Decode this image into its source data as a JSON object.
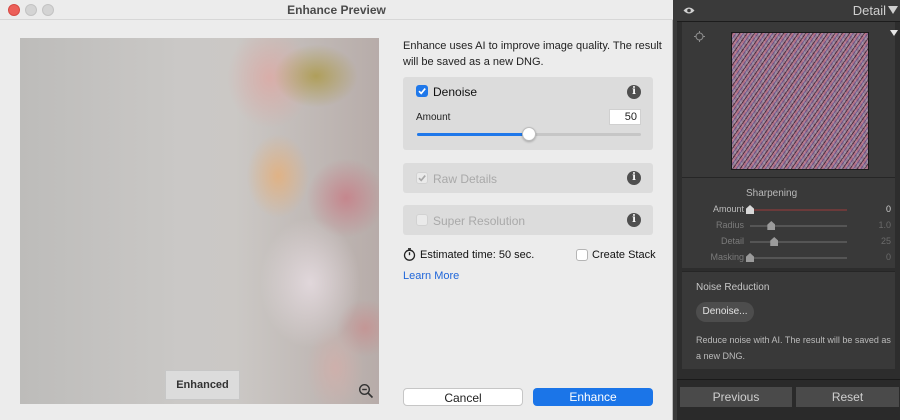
{
  "dialog": {
    "title": "Enhance Preview",
    "preview_label": "Enhanced",
    "description": "Enhance uses AI to improve image quality. The result will be saved as a new DNG.",
    "options": {
      "denoise": {
        "label": "Denoise",
        "checked": true,
        "amount_label": "Amount",
        "amount_value": "50",
        "amount_fraction": 0.5
      },
      "raw_details": {
        "label": "Raw Details",
        "checked": true,
        "enabled": false
      },
      "super_resolution": {
        "label": "Super Resolution",
        "checked": false,
        "enabled": false
      }
    },
    "estimated_time": "Estimated time: 50 sec.",
    "create_stack": {
      "label": "Create Stack",
      "checked": false
    },
    "learn_more": "Learn More",
    "buttons": {
      "cancel": "Cancel",
      "enhance": "Enhance"
    }
  },
  "panel": {
    "header_title": "Detail",
    "sharpening": {
      "title": "Sharpening",
      "sliders": [
        {
          "label": "Amount",
          "value": "0",
          "fraction": 0.0,
          "enabled": true
        },
        {
          "label": "Radius",
          "value": "1.0",
          "fraction": 0.22,
          "enabled": false
        },
        {
          "label": "Detail",
          "value": "25",
          "fraction": 0.25,
          "enabled": false
        },
        {
          "label": "Masking",
          "value": "0",
          "fraction": 0.0,
          "enabled": false
        }
      ]
    },
    "noise_reduction": {
      "title": "Noise Reduction",
      "button": "Denoise...",
      "description": "Reduce noise with AI. The result will be saved as a new DNG."
    },
    "footer": {
      "previous": "Previous",
      "reset": "Reset"
    }
  },
  "colors": {
    "accent": "#1f78ea",
    "enhance_button": "#1b75e8",
    "link": "#2167d9",
    "close_button": "#ec5f59"
  },
  "icons": [
    "info-icon",
    "zoom-out-icon",
    "timer-icon",
    "eye-icon",
    "target-icon",
    "collapse-triangle-icon"
  ]
}
